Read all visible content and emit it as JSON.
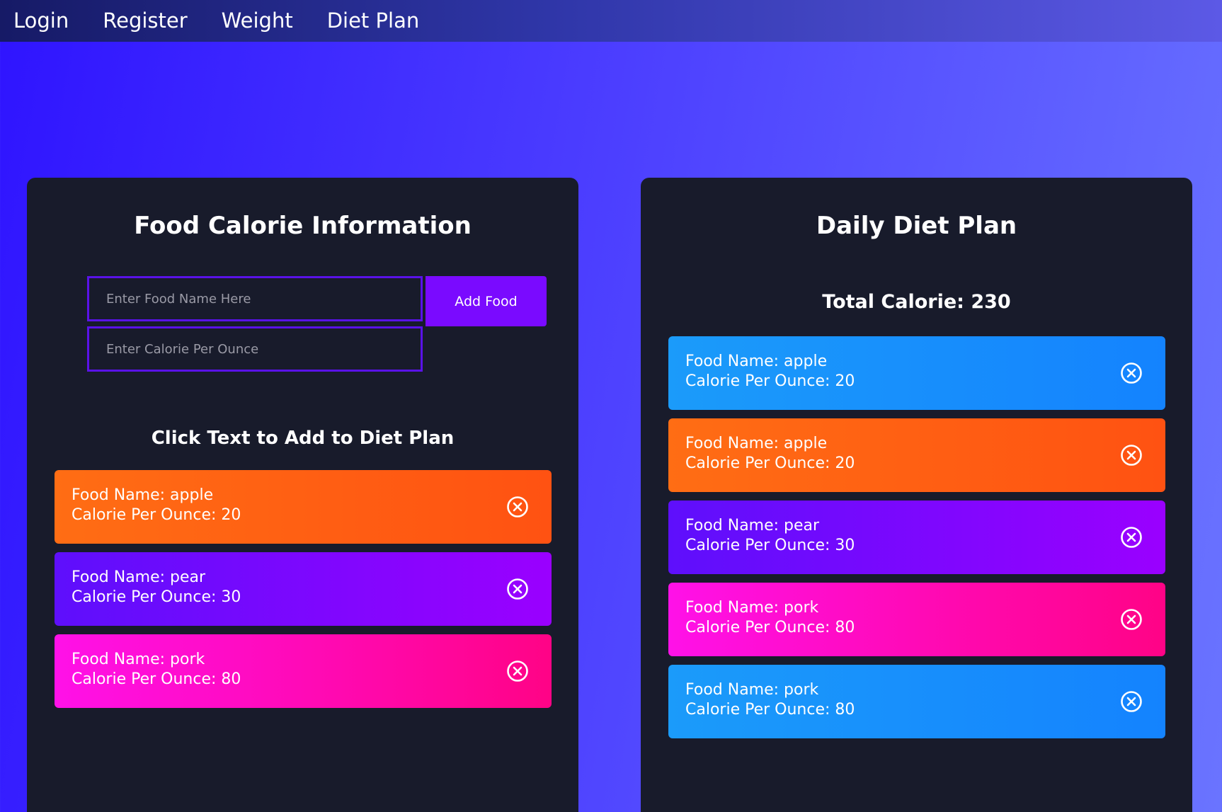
{
  "nav": {
    "items": [
      {
        "label": "Login"
      },
      {
        "label": "Register"
      },
      {
        "label": "Weight"
      },
      {
        "label": "Diet Plan"
      }
    ]
  },
  "food_info": {
    "title": "Food Calorie Information",
    "food_name_placeholder": "Enter Food Name Here",
    "calorie_placeholder": "Enter Calorie Per Ounce",
    "add_button_label": "Add Food",
    "click_heading": "Click Text to Add to Diet Plan",
    "items": [
      {
        "name": "Food Name: apple",
        "calorie": "Calorie Per Ounce: 20",
        "color": "#ff6512"
      },
      {
        "name": "Food Name: pear",
        "calorie": "Calorie Per Ounce: 30",
        "color": "#7f08ff"
      },
      {
        "name": "Food Name: pork",
        "calorie": "Calorie Per Ounce: 80",
        "color": "#ff0bb6"
      }
    ]
  },
  "diet_plan": {
    "title": "Daily Diet Plan",
    "total_calorie": "Total Calorie: 230",
    "items": [
      {
        "name": "Food Name: apple",
        "calorie": "Calorie Per Ounce: 20",
        "color": "#1890fc"
      },
      {
        "name": "Food Name: apple",
        "calorie": "Calorie Per Ounce: 20",
        "color": "#ff6512"
      },
      {
        "name": "Food Name: pear",
        "calorie": "Calorie Per Ounce: 30",
        "color": "#7f08ff"
      },
      {
        "name": "Food Name: pork",
        "calorie": "Calorie Per Ounce: 80",
        "color": "#ff0bb6"
      },
      {
        "name": "Food Name: pork",
        "calorie": "Calorie Per Ounce: 80",
        "color": "#1890fc"
      }
    ]
  },
  "icons": {
    "remove": "close-circle-icon"
  }
}
